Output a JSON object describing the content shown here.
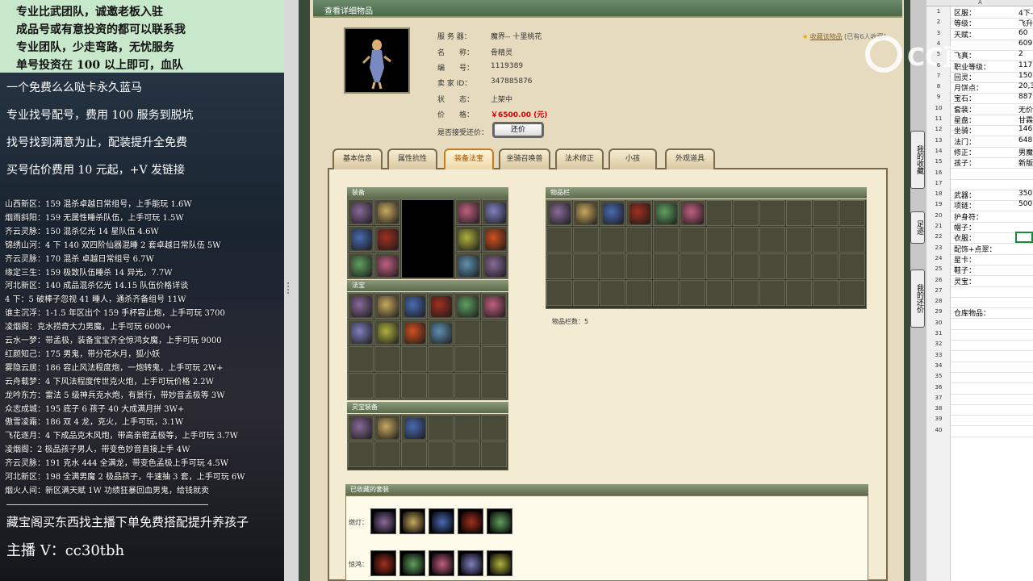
{
  "left_panel": {
    "top_lines": [
      "专业比武团队，诚邀老板入驻",
      "成品号或有意投资的都可以联系我",
      "专业团队，少走弯路，无忧服务",
      "单号投资在 100 以上即可，血队"
    ],
    "service_lines": [
      "一个免费么么哒卡永久蓝马",
      "专业找号配号，费用 100 服务到脱坑",
      "找号找到满意为止，配装提升全免费",
      "买号估价费用 10 元起，+V 发链接"
    ],
    "roster": [
      "山西新区：159 混杀卓越日常组号，上手能玩 1.6W",
      "烟雨斜阳：159 无属性睡杀队伍，上手可玩 1.5W",
      "齐云灵脉：150 混杀亿光 14 星队伍 4.6W",
      "锦绣山河：4 下 140 双四阶仙器混睡 2 套卓越日常队伍 5W",
      "齐云灵脉：170 混杀 卓越日常组号 6.7W",
      "缘定三生：159 极致队伍睡杀 14 异光，7.7W",
      "河北新区：140 成品混杀亿光 14.15 队伍价格详谈",
      "4 下：5 破棒子忽视 41 睡人，通杀齐备组号 11W",
      "谁主沉浮：1-1.5 年区出个 159 手杯容止炮，上手可玩 3700",
      "凌烟阁：克水捞奇大力男魔，上手可玩 6000+",
      "云水一梦：带孟极，装备宝宝齐全惊鸿女魔，上手可玩 9000",
      "红颜知己：175 男鬼，带分花水月，狐小妖",
      "雾隐云居：186 容止风法程度炮，一炮转鬼，上手可玩 2W+",
      "云舟载梦：4 下风法程度传世克火炮，上手可玩价格 2.2W",
      "龙吟东方：雷法 5 级神兵克水炮，有景行，带妙音孟极等 3W",
      "众志成城：195 底子 6 孩子 40 大成满月拼 3W+",
      "傲雪凌霜：186 双 4 龙，克火，上手可玩，3.1W",
      "飞花逐月：4 下成品克木风炮，带高亲密孟极等，上手可玩 3.7W",
      "凌烟阁：2 极品孩子男人，带变色妙音直接上手 4W",
      "齐云灵脉：191 克水 444 全满龙，带变色孟极上手可玩 4.5W",
      "河北新区：198 全满男魔 2 极品孩子，牛速抽 3 套，上手可玩 6W",
      "烟火人间：新区满天赋 1W 功绩狂暴回血男鬼，给钱就卖"
    ],
    "footer_line1": "藏宝阁买东西找主播下单免费搭配提升养孩子",
    "footer_line2": "主播 V：cc30tbh"
  },
  "panel": {
    "title": "查看详细物品",
    "fields": [
      {
        "label": "服 务 器：",
        "value": "魔界-- 十里桃花"
      },
      {
        "label": "名　　称：",
        "value": "骨精灵"
      },
      {
        "label": "编　　号：",
        "value": "1119389"
      },
      {
        "label": "卖 家 ID：",
        "value": "347885876"
      },
      {
        "label": "状　　态：",
        "value": "上架中"
      },
      {
        "label": "价　　格：",
        "value": "￥6500.00 (元)"
      },
      {
        "label": "是否接受还价：",
        "value": ""
      }
    ],
    "bargain_button": "还价",
    "favorite_link": "收藏该物品",
    "favorite_count": "[已有6人收藏]",
    "tabs": [
      "基本信息",
      "属性抗性",
      "装备法宝",
      "坐骑召唤兽",
      "法术修正",
      "小孩",
      "外观道具"
    ],
    "active_tab": 2,
    "sections": {
      "equip": "装备",
      "treasure": "法宝",
      "spirit": "灵宝装备",
      "bag": "物品栏",
      "collected": "已收藏的套装"
    },
    "bag_count_label": "物品栏数：5",
    "set_labels": [
      "燃灯：",
      "惊鸿："
    ]
  },
  "right_tabs": [
    "我的收藏",
    "足迹",
    "我的还价"
  ],
  "sheet": {
    "column_header": "A",
    "rows": [
      {
        "n": "1",
        "a": "区服：",
        "b": "4下-"
      },
      {
        "n": "2",
        "a": "等级：",
        "b": "飞升"
      },
      {
        "n": "3",
        "a": "天赋：",
        "b": "60"
      },
      {
        "n": "4",
        "a": "",
        "b": "609"
      },
      {
        "n": "5",
        "a": "飞真：",
        "b": "2"
      },
      {
        "n": "6",
        "a": "职业等级：",
        "b": "117"
      },
      {
        "n": "7",
        "a": "回灵：",
        "b": "150"
      },
      {
        "n": "8",
        "a": "月饼点：",
        "b": "20,3"
      },
      {
        "n": "9",
        "a": "宝石：",
        "b": "887"
      },
      {
        "n": "10",
        "a": "套装：",
        "b": "无价"
      },
      {
        "n": "11",
        "a": "星盘：",
        "b": "甘霖"
      },
      {
        "n": "12",
        "a": "坐骑：",
        "b": "146"
      },
      {
        "n": "13",
        "a": "法门：",
        "b": "648"
      },
      {
        "n": "14",
        "a": "修正：",
        "b": "男魔"
      },
      {
        "n": "15",
        "a": "孩子：",
        "b": "新版"
      },
      {
        "n": "16",
        "a": "",
        "b": ""
      },
      {
        "n": "17",
        "a": "",
        "b": ""
      },
      {
        "n": "18",
        "a": "武器：",
        "b": "350"
      },
      {
        "n": "19",
        "a": "项链：",
        "b": "500"
      },
      {
        "n": "20",
        "a": "护身符：",
        "b": ""
      },
      {
        "n": "21",
        "a": "帽子：",
        "b": ""
      },
      {
        "n": "22",
        "a": "衣服：",
        "b": ""
      },
      {
        "n": "23",
        "a": "配饰+点翠：",
        "b": ""
      },
      {
        "n": "24",
        "a": "星卡：",
        "b": ""
      },
      {
        "n": "25",
        "a": "鞋子：",
        "b": ""
      },
      {
        "n": "26",
        "a": "灵宝：",
        "b": ""
      },
      {
        "n": "27",
        "a": "",
        "b": ""
      },
      {
        "n": "28",
        "a": "",
        "b": ""
      },
      {
        "n": "29",
        "a": "仓库物品：",
        "b": ""
      },
      {
        "n": "30",
        "a": "",
        "b": ""
      },
      {
        "n": "31",
        "a": "",
        "b": ""
      },
      {
        "n": "32",
        "a": "",
        "b": ""
      },
      {
        "n": "33",
        "a": "",
        "b": ""
      },
      {
        "n": "34",
        "a": "",
        "b": ""
      },
      {
        "n": "35",
        "a": "",
        "b": ""
      },
      {
        "n": "36",
        "a": "",
        "b": ""
      },
      {
        "n": "37",
        "a": "",
        "b": ""
      },
      {
        "n": "38",
        "a": "",
        "b": ""
      },
      {
        "n": "39",
        "a": "",
        "b": ""
      },
      {
        "n": "40",
        "a": "",
        "b": ""
      }
    ]
  },
  "watermark": "CC直播"
}
